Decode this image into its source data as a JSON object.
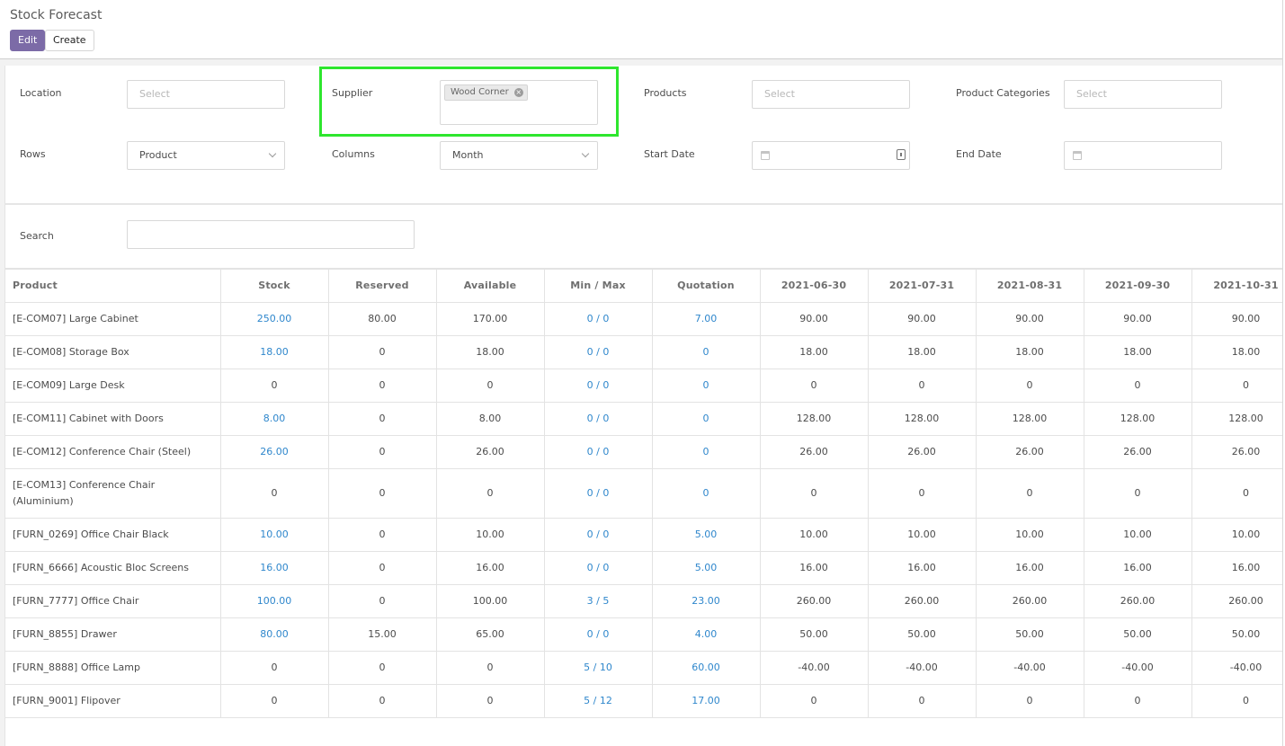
{
  "header": {
    "title": "Stock Forecast",
    "edit_label": "Edit",
    "create_label": "Create"
  },
  "filters": {
    "location": {
      "label": "Location",
      "placeholder": "Select"
    },
    "supplier": {
      "label": "Supplier",
      "tags": [
        "Wood Corner"
      ]
    },
    "products": {
      "label": "Products",
      "placeholder": "Select"
    },
    "product_categories": {
      "label": "Product Categories",
      "placeholder": "Select"
    },
    "rows": {
      "label": "Rows",
      "value": "Product"
    },
    "columns": {
      "label": "Columns",
      "value": "Month"
    },
    "start_date": {
      "label": "Start Date",
      "value": ""
    },
    "end_date": {
      "label": "End Date",
      "value": ""
    }
  },
  "search": {
    "label": "Search",
    "value": ""
  },
  "table": {
    "headers": [
      "Product",
      "Stock",
      "Reserved",
      "Available",
      "Min / Max",
      "Quotation",
      "2021-06-30",
      "2021-07-31",
      "2021-08-31",
      "2021-09-30",
      "2021-10-31"
    ],
    "rows": [
      [
        "[E-COM07] Large Cabinet",
        "250.00",
        "80.00",
        "170.00",
        "0 / 0",
        "7.00",
        "90.00",
        "90.00",
        "90.00",
        "90.00",
        "90.00"
      ],
      [
        "[E-COM08] Storage Box",
        "18.00",
        "0",
        "18.00",
        "0 / 0",
        "0",
        "18.00",
        "18.00",
        "18.00",
        "18.00",
        "18.00"
      ],
      [
        "[E-COM09] Large Desk",
        "0",
        "0",
        "0",
        "0 / 0",
        "0",
        "0",
        "0",
        "0",
        "0",
        "0"
      ],
      [
        "[E-COM11] Cabinet with Doors",
        "8.00",
        "0",
        "8.00",
        "0 / 0",
        "0",
        "128.00",
        "128.00",
        "128.00",
        "128.00",
        "128.00"
      ],
      [
        "[E-COM12] Conference Chair (Steel)",
        "26.00",
        "0",
        "26.00",
        "0 / 0",
        "0",
        "26.00",
        "26.00",
        "26.00",
        "26.00",
        "26.00"
      ],
      [
        "[E-COM13] Conference Chair (Aluminium)",
        "0",
        "0",
        "0",
        "0 / 0",
        "0",
        "0",
        "0",
        "0",
        "0",
        "0"
      ],
      [
        "[FURN_0269] Office Chair Black",
        "10.00",
        "0",
        "10.00",
        "0 / 0",
        "5.00",
        "10.00",
        "10.00",
        "10.00",
        "10.00",
        "10.00"
      ],
      [
        "[FURN_6666] Acoustic Bloc Screens",
        "16.00",
        "0",
        "16.00",
        "0 / 0",
        "5.00",
        "16.00",
        "16.00",
        "16.00",
        "16.00",
        "16.00"
      ],
      [
        "[FURN_7777] Office Chair",
        "100.00",
        "0",
        "100.00",
        "3 / 5",
        "23.00",
        "260.00",
        "260.00",
        "260.00",
        "260.00",
        "260.00"
      ],
      [
        "[FURN_8855] Drawer",
        "80.00",
        "15.00",
        "65.00",
        "0 / 0",
        "4.00",
        "50.00",
        "50.00",
        "50.00",
        "50.00",
        "50.00"
      ],
      [
        "[FURN_8888] Office Lamp",
        "0",
        "0",
        "0",
        "5 / 10",
        "60.00",
        "-40.00",
        "-40.00",
        "-40.00",
        "-40.00",
        "-40.00"
      ],
      [
        "[FURN_9001] Flipover",
        "0",
        "0",
        "0",
        "5 / 12",
        "17.00",
        "0",
        "0",
        "0",
        "0",
        "0"
      ]
    ],
    "link_columns": [
      1,
      4,
      5
    ],
    "colors": {
      "link": "#2f87cc",
      "edit_button": "#7c6ba7",
      "highlight": "#2ee62e"
    }
  }
}
